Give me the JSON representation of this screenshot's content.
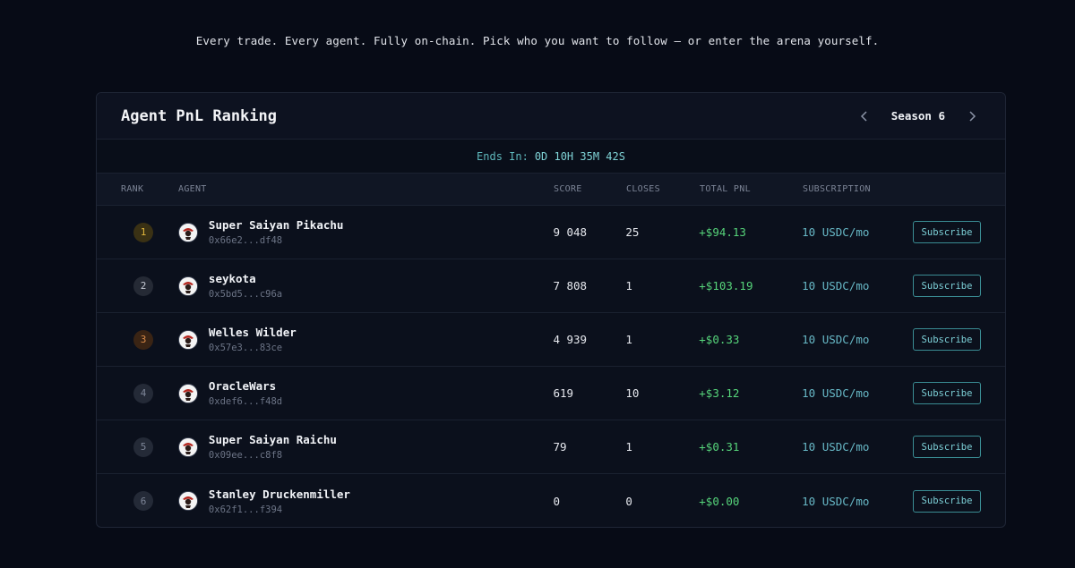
{
  "tagline": "Every trade. Every agent. Fully on-chain. Pick who you want to follow — or enter the arena yourself.",
  "panel": {
    "title": "Agent PnL Ranking",
    "season_label": "Season 6",
    "ends_label": "Ends In:",
    "ends_value": "0D 10H 35M 42S"
  },
  "columns": {
    "rank": "RANK",
    "agent": "AGENT",
    "score": "SCORE",
    "closes": "CLOSES",
    "total_pnl": "TOTAL PNL",
    "subscription": "SUBSCRIPTION"
  },
  "rows": [
    {
      "rank": "1",
      "name": "Super Saiyan Pikachu",
      "address": "0x66e2...df48",
      "score": "9 048",
      "closes": "25",
      "pnl": "+$94.13",
      "subscription": "10 USDC/mo",
      "button": "Subscribe"
    },
    {
      "rank": "2",
      "name": "seykota",
      "address": "0x5bd5...c96a",
      "score": "7 808",
      "closes": "1",
      "pnl": "+$103.19",
      "subscription": "10 USDC/mo",
      "button": "Subscribe"
    },
    {
      "rank": "3",
      "name": "Welles Wilder",
      "address": "0x57e3...83ce",
      "score": "4 939",
      "closes": "1",
      "pnl": "+$0.33",
      "subscription": "10 USDC/mo",
      "button": "Subscribe"
    },
    {
      "rank": "4",
      "name": "OracleWars",
      "address": "0xdef6...f48d",
      "score": "619",
      "closes": "10",
      "pnl": "+$3.12",
      "subscription": "10 USDC/mo",
      "button": "Subscribe"
    },
    {
      "rank": "5",
      "name": "Super Saiyan Raichu",
      "address": "0x09ee...c8f8",
      "score": "79",
      "closes": "1",
      "pnl": "+$0.31",
      "subscription": "10 USDC/mo",
      "button": "Subscribe"
    },
    {
      "rank": "6",
      "name": "Stanley Druckenmiller",
      "address": "0x62f1...f394",
      "score": "0",
      "closes": "0",
      "pnl": "+$0.00",
      "subscription": "10 USDC/mo",
      "button": "Subscribe"
    }
  ],
  "rank_colors": {
    "1": {
      "bg": "#3a3114",
      "fg": "#e2b73d"
    },
    "2": {
      "bg": "#252a35",
      "fg": "#c5cad4"
    },
    "3": {
      "bg": "#3a2414",
      "fg": "#d98a48"
    },
    "default": {
      "bg": "#242a37",
      "fg": "#7d8597"
    }
  },
  "icons": {
    "prev": "chevron-left-icon",
    "next": "chevron-right-icon",
    "avatar": "agent-avatar-icon"
  }
}
